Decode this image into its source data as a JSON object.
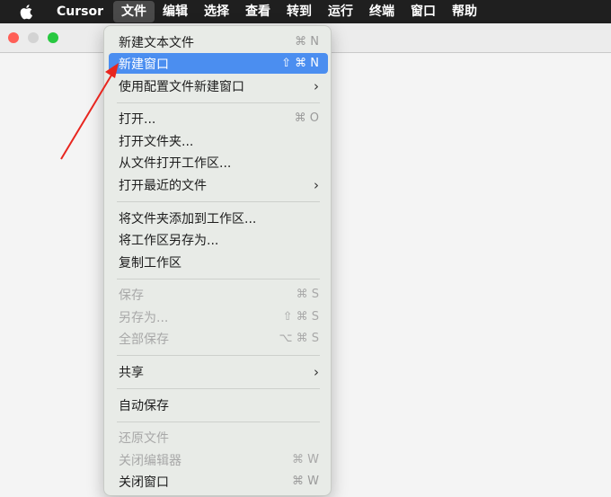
{
  "menubar": {
    "app_name": "Cursor",
    "items": [
      "文件",
      "编辑",
      "选择",
      "查看",
      "转到",
      "运行",
      "终端",
      "窗口",
      "帮助"
    ],
    "active_index": 0
  },
  "menu": {
    "items": [
      {
        "label": "新建文本文件",
        "shortcut": "⌘ N"
      },
      {
        "label": "新建窗口",
        "shortcut": "⇧ ⌘ N"
      },
      {
        "label": "使用配置文件新建窗口",
        "shortcut": "›"
      },
      {
        "label": "打开...",
        "shortcut": "⌘ O"
      },
      {
        "label": "打开文件夹...",
        "shortcut": ""
      },
      {
        "label": "从文件打开工作区...",
        "shortcut": ""
      },
      {
        "label": "打开最近的文件",
        "shortcut": "›"
      },
      {
        "label": "将文件夹添加到工作区...",
        "shortcut": ""
      },
      {
        "label": "将工作区另存为...",
        "shortcut": ""
      },
      {
        "label": "复制工作区",
        "shortcut": ""
      },
      {
        "label": "保存",
        "shortcut": "⌘ S"
      },
      {
        "label": "另存为...",
        "shortcut": "⇧ ⌘ S"
      },
      {
        "label": "全部保存",
        "shortcut": "⌥ ⌘ S"
      },
      {
        "label": "共享",
        "shortcut": "›"
      },
      {
        "label": "自动保存",
        "shortcut": ""
      },
      {
        "label": "还原文件",
        "shortcut": ""
      },
      {
        "label": "关闭编辑器",
        "shortcut": "⌘ W"
      },
      {
        "label": "关闭窗口",
        "shortcut": "⌘ W"
      }
    ]
  },
  "colors": {
    "highlight": "#4b8ef0",
    "annotation_arrow": "#e8261f"
  }
}
